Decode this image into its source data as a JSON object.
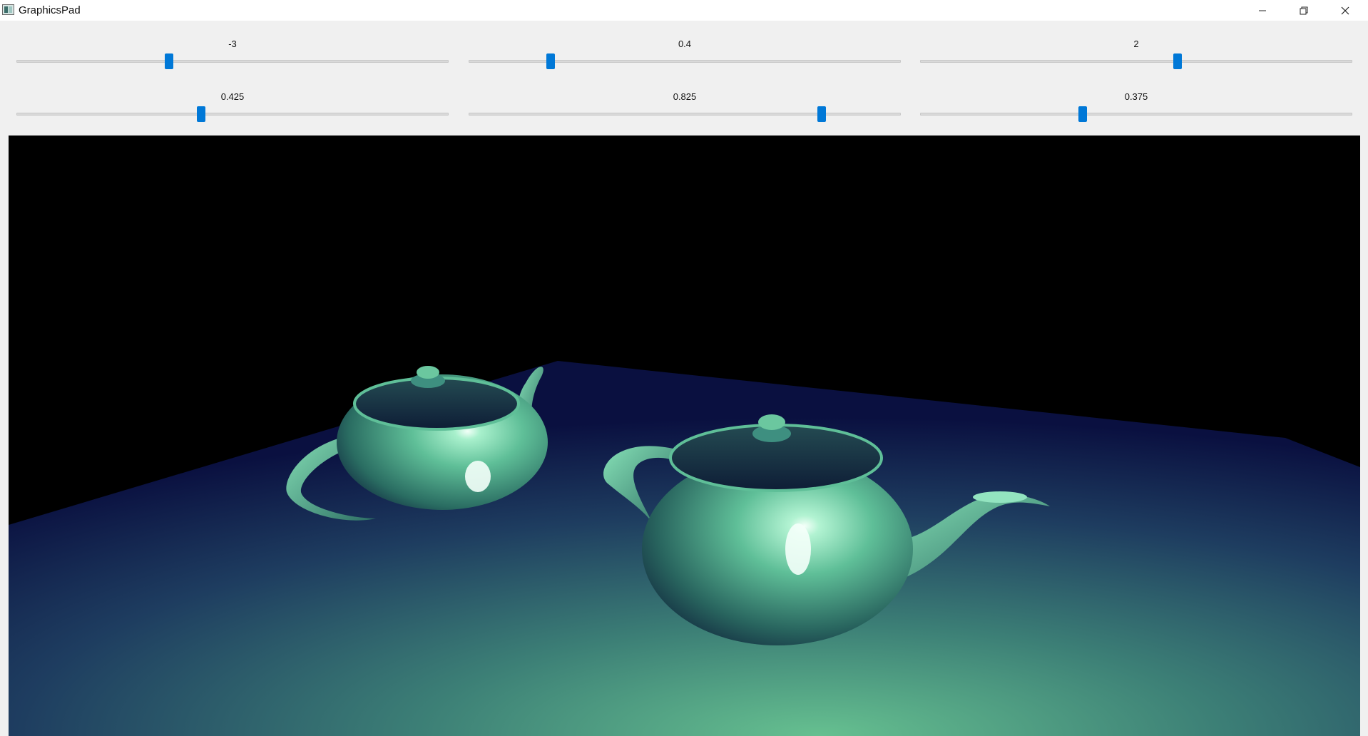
{
  "window": {
    "title": "GraphicsPad",
    "icon": "app-icon",
    "controls": [
      "minimize-icon",
      "restore-icon",
      "close-icon"
    ]
  },
  "sliders": [
    {
      "label": "-3",
      "value": -3,
      "position": 0.353
    },
    {
      "label": "0.4",
      "value": 0.4,
      "position": 0.19
    },
    {
      "label": "2",
      "value": 2,
      "position": 0.596
    },
    {
      "label": "0.425",
      "value": 0.425,
      "position": 0.427
    },
    {
      "label": "0.825",
      "value": 0.825,
      "position": 0.817
    },
    {
      "label": "0.375",
      "value": 0.375,
      "position": 0.377
    }
  ],
  "viewport": {
    "scene": "two teapots on a plane",
    "background_color": "#000000",
    "floor_color": "#1a2a5a",
    "light_color": "#66c090",
    "teapot_color": "#5fbf98"
  },
  "colors": {
    "accent": "#0078d7",
    "panel": "#f0f0f0"
  }
}
